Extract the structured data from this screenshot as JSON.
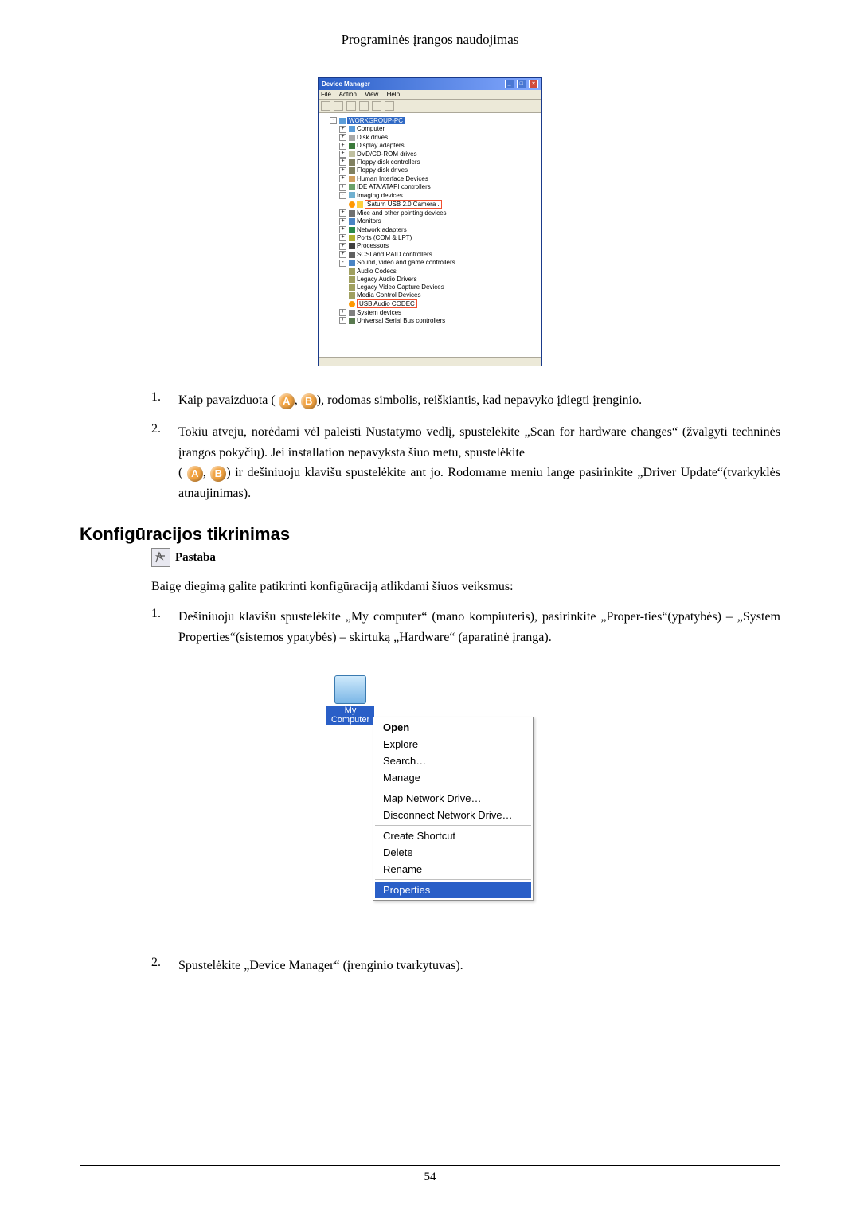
{
  "header_title": "Programinės įrangos naudojimas",
  "devmgr": {
    "title": "Device Manager",
    "menus": [
      "File",
      "Action",
      "View",
      "Help"
    ],
    "root": "WORKGROUP-PC",
    "nodes": {
      "computer": "Computer",
      "disk": "Disk drives",
      "display": "Display adapters",
      "dvd": "DVD/CD-ROM drives",
      "floppyctl": "Floppy disk controllers",
      "floppy": "Floppy disk drives",
      "hid": "Human Interface Devices",
      "ide": "IDE ATA/ATAPI controllers",
      "imaging": "Imaging devices",
      "camera": "Saturn USB 2.0 Camera .",
      "mice": "Mice and other pointing devices",
      "monitors": "Monitors",
      "net": "Network adapters",
      "ports": "Ports (COM & LPT)",
      "cpu": "Processors",
      "scsi": "SCSI and RAID controllers",
      "sound": "Sound, video and game controllers",
      "audiocodecs": "Audio Codecs",
      "legacyaudio": "Legacy Audio Drivers",
      "legacyvcap": "Legacy Video Capture Devices",
      "mediactrl": "Media Control Devices",
      "usbaudio": "USB Audio CODEC",
      "system": "System devices",
      "usb": "Universal Serial Bus controllers"
    }
  },
  "list1": {
    "item1": {
      "num": "1.",
      "pre": "Kaip pavaizduota (",
      "a": "A",
      "mid": ", ",
      "b": "B",
      "post": "), rodomas simbolis, reiškiantis, kad nepavyko įdiegti įrenginio."
    },
    "item2": {
      "num": "2.",
      "line1": "Tokiu atveju, norėdami vėl paleisti Nustatymo vedlį, spustelėkite „Scan for hardware changes“ (žvalgyti techninės įrangos pokyčių). Jei installation nepavyksta šiuo metu, spustelėkite",
      "pre2": "(",
      "a": "A",
      "mid": ", ",
      "b": "B",
      "post2": ") ir dešiniuoju klavišu spustelėkite ant jo. Rodomame meniu lange pasirinkite „Driver Update“(tvarkyklės atnaujinimas)."
    }
  },
  "section_title": "Konfigūracijos tikrinimas",
  "note_label": "Pastaba",
  "intro_text": "Baigę diegimą galite patikrinti konfigūraciją atlikdami šiuos veiksmus:",
  "list2": {
    "item1": {
      "num": "1.",
      "text": "Dešiniuoju klavišu spustelėkite „My computer“ (mano kompiuteris), pasirinkite „Proper-ties“(ypatybės) – „System Properties“(sistemos ypatybės) – skirtuką „Hardware“ (aparatinė įranga)."
    },
    "item2": {
      "num": "2.",
      "text": "Spustelėkite „Device Manager“ (įrenginio tvarkytuvas)."
    }
  },
  "mycomputer_label": "My Computer",
  "ctx": {
    "open": "Open",
    "explore": "Explore",
    "search": "Search…",
    "manage": "Manage",
    "map": "Map Network Drive…",
    "disc": "Disconnect Network Drive…",
    "shortcut": "Create Shortcut",
    "delete": "Delete",
    "rename": "Rename",
    "props": "Properties"
  },
  "page_number": "54"
}
